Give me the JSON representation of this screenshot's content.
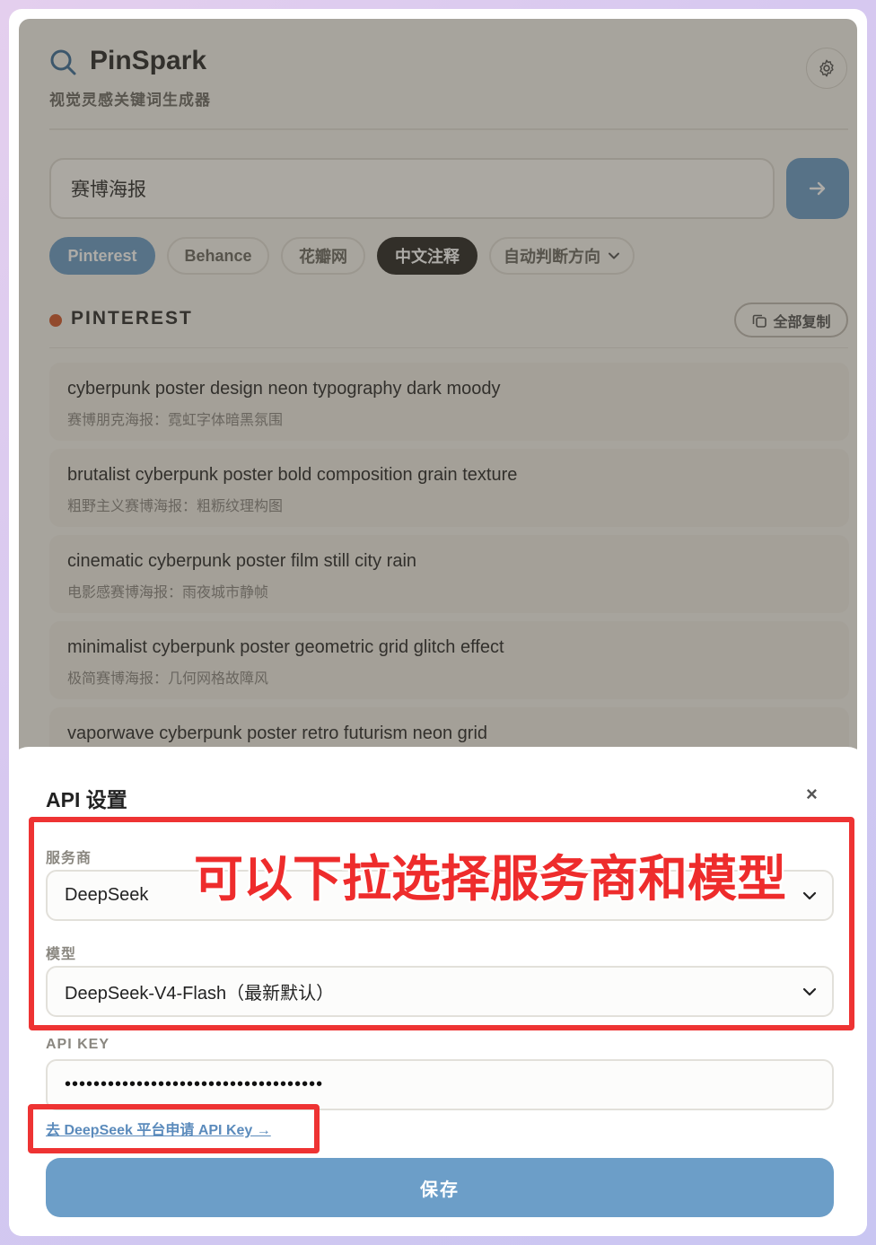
{
  "app": {
    "title": "PinSpark",
    "subtitle": "视觉灵感关键词生成器"
  },
  "search": {
    "value": "赛博海报"
  },
  "chips": [
    {
      "label": "Pinterest"
    },
    {
      "label": "Behance"
    },
    {
      "label": "花瓣网"
    },
    {
      "label": "中文注释"
    },
    {
      "label": "自动判断方向"
    }
  ],
  "section": {
    "title": "PINTEREST",
    "copy_all": "全部复制"
  },
  "results": [
    {
      "en": "cyberpunk poster design neon typography dark moody",
      "zh": "赛博朋克海报：霓虹字体暗黑氛围"
    },
    {
      "en": "brutalist cyberpunk poster bold composition grain texture",
      "zh": "粗野主义赛博海报：粗粝纹理构图"
    },
    {
      "en": "cinematic cyberpunk poster film still city rain",
      "zh": "电影感赛博海报：雨夜城市静帧"
    },
    {
      "en": "minimalist cyberpunk poster geometric grid glitch effect",
      "zh": "极简赛博海报：几何网格故障风"
    },
    {
      "en": "vaporwave cyberpunk poster retro futurism neon grid",
      "zh": ""
    }
  ],
  "modal": {
    "title": "API 设置",
    "close": "×",
    "provider_label": "服务商",
    "provider_value": "DeepSeek",
    "model_label": "模型",
    "model_value": "DeepSeek-V4-Flash（最新默认）",
    "key_label": "API KEY",
    "key_value": "••••••••••••••••••••••••••••••••••••",
    "apply_link": "去 DeepSeek 平台申请 API Key →",
    "save": "保存"
  },
  "annotation": {
    "text": "可以下拉选择服务商和模型",
    "color": "#ee3333"
  },
  "colors": {
    "accent": "#6c9ec8",
    "dark_chip": "#2c2a26",
    "section_dot": "#d0582e"
  }
}
